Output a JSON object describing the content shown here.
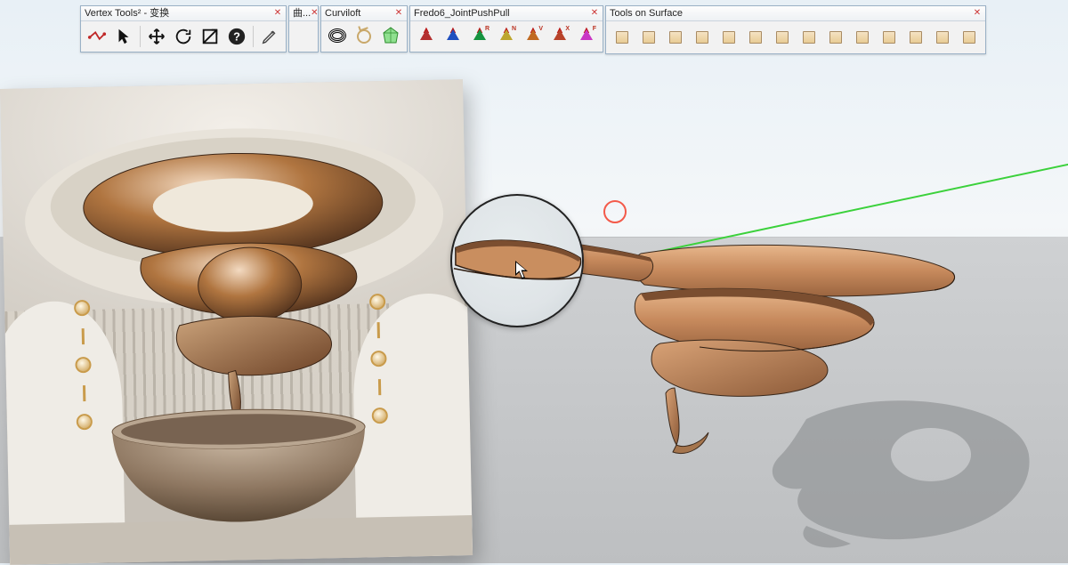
{
  "toolbars": {
    "vertex": {
      "title": "Vertex Tools² - 变换",
      "buttons": [
        {
          "name": "polyline-icon"
        },
        {
          "name": "select-arrow-icon"
        },
        {
          "name": "move-icon"
        },
        {
          "name": "rotate-icon"
        },
        {
          "name": "scale-icon"
        },
        {
          "name": "help-icon"
        },
        {
          "name": "pencil-edit-icon"
        }
      ]
    },
    "qu": {
      "title": "曲..."
    },
    "curviloft": {
      "title": "Curviloft",
      "buttons": [
        {
          "name": "nested-ellipse-icon"
        },
        {
          "name": "loop-loft-icon"
        },
        {
          "name": "skin-crystal-icon"
        }
      ]
    },
    "jpp": {
      "title": "Fredo6_JointPushPull",
      "buttons": [
        {
          "name": "jpp-joint-icon",
          "letter": "",
          "color": "#b43131"
        },
        {
          "name": "jpp-round-icon",
          "letter": "",
          "color": "#1f4fbf"
        },
        {
          "name": "jpp-vector-icon",
          "letter": "R",
          "color": "#16933f"
        },
        {
          "name": "jpp-normal-icon",
          "letter": "N",
          "color": "#bda62d"
        },
        {
          "name": "jpp-extrude-icon",
          "letter": "V",
          "color": "#c06a22"
        },
        {
          "name": "jpp-follow-icon",
          "letter": "X",
          "color": "#b8432a"
        },
        {
          "name": "jpp-custom-icon",
          "letter": "F",
          "color": "#c937c4"
        }
      ]
    },
    "tos": {
      "title": "Tools on Surface",
      "count": 14
    }
  },
  "viewport": {
    "origin_marker": "origin",
    "magnifier_label": "magnifier",
    "cursor_label": "arrow-cursor",
    "reference_label": "reference-photo"
  }
}
